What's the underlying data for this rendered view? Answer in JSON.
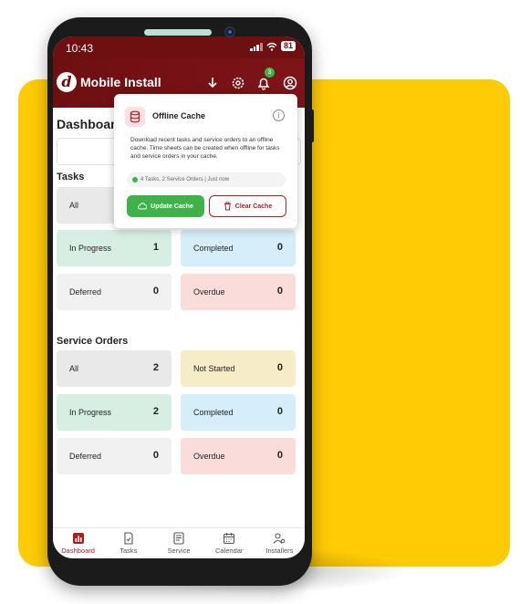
{
  "status_bar": {
    "time": "10:43",
    "battery": "81"
  },
  "app_bar": {
    "logo_letter": "d",
    "title": "Mobile Install",
    "notification_count": "3"
  },
  "dashboard": {
    "title": "Dashboard"
  },
  "tasks": {
    "title": "Tasks",
    "cards": [
      {
        "label": "All",
        "count": ""
      },
      {
        "label": "In Progress",
        "count": "1"
      },
      {
        "label": "Completed",
        "count": "0"
      },
      {
        "label": "Deferred",
        "count": "0"
      },
      {
        "label": "Overdue",
        "count": "0"
      }
    ]
  },
  "service_orders": {
    "title": "Service Orders",
    "cards": [
      {
        "label": "All",
        "count": "2"
      },
      {
        "label": "Not Started",
        "count": "0"
      },
      {
        "label": "In Progress",
        "count": "2"
      },
      {
        "label": "Completed",
        "count": "0"
      },
      {
        "label": "Deferred",
        "count": "0"
      },
      {
        "label": "Overdue",
        "count": "0"
      }
    ]
  },
  "offline_cache": {
    "title": "Offline Cache",
    "info_icon": "i",
    "description": "Download recent tasks and service orders to an offline cache. Time sheets can be created when offline for tasks and service orders in your cache.",
    "status": "4 Tasks, 2 Service Orders | Just now",
    "update_label": "Update Cache",
    "clear_label": "Clear Cache"
  },
  "bottom_nav": [
    {
      "label": "Dashboard",
      "icon": "chart-icon"
    },
    {
      "label": "Tasks",
      "icon": "task-icon"
    },
    {
      "label": "Service",
      "icon": "service-icon"
    },
    {
      "label": "Calendar",
      "icon": "calendar-icon"
    },
    {
      "label": "Installers",
      "icon": "installers-icon"
    }
  ],
  "colors": {
    "brand": "#6e0f12",
    "accent_green": "#3fb24a",
    "danger": "#b01e23",
    "backdrop": "#FFCB05"
  }
}
